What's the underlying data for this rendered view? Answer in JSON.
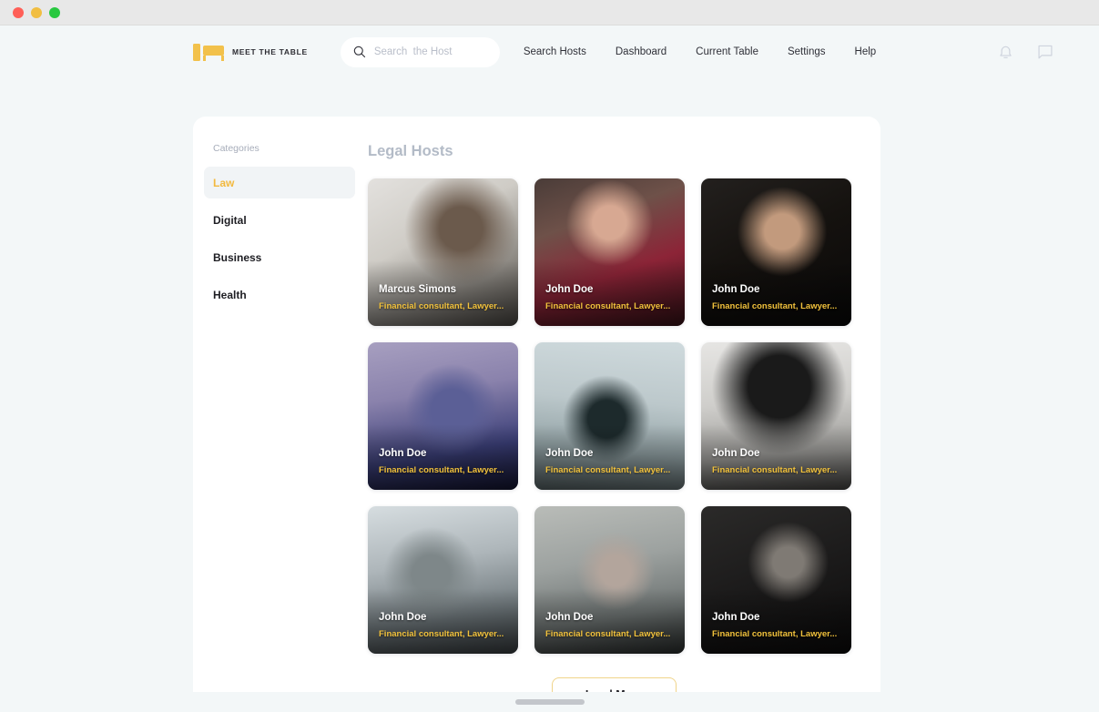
{
  "window": {
    "controls": [
      {
        "name": "close",
        "color": "#ff5f57"
      },
      {
        "name": "minimize",
        "color": "#f1be42"
      },
      {
        "name": "maximize",
        "color": "#28c840"
      }
    ]
  },
  "header": {
    "brand_text": "MEET THE TABLE",
    "brand_icon": "table-logo-icon",
    "search": {
      "icon": "search-icon",
      "placeholder": "Search  the Host",
      "value": ""
    },
    "nav_links": [
      {
        "label": "Search Hosts"
      },
      {
        "label": "Dashboard"
      },
      {
        "label": "Current Table"
      },
      {
        "label": "Settings"
      },
      {
        "label": "Help"
      }
    ],
    "icons": [
      {
        "name": "bell-icon",
        "label": "Notifications"
      },
      {
        "name": "chat-icon",
        "label": "Messages"
      }
    ]
  },
  "sidebar": {
    "title": "Categories",
    "items": [
      {
        "label": "Law",
        "active": true
      },
      {
        "label": "Digital",
        "active": false
      },
      {
        "label": "Business",
        "active": false
      },
      {
        "label": "Health",
        "active": false
      }
    ]
  },
  "main": {
    "title": "Legal Hosts",
    "cards": [
      {
        "name": "Marcus Simons",
        "role": "Financial consultant, Lawyer..."
      },
      {
        "name": "John Doe",
        "role": "Financial consultant, Lawyer..."
      },
      {
        "name": "John Doe",
        "role": "Financial consultant, Lawyer..."
      },
      {
        "name": "John Doe",
        "role": "Financial consultant, Lawyer..."
      },
      {
        "name": "John Doe",
        "role": "Financial consultant, Lawyer..."
      },
      {
        "name": "John Doe",
        "role": "Financial consultant, Lawyer..."
      },
      {
        "name": "John Doe",
        "role": "Financial consultant, Lawyer..."
      },
      {
        "name": "John Doe",
        "role": "Financial consultant, Lawyer..."
      },
      {
        "name": "John Doe",
        "role": "Financial consultant, Lawyer..."
      }
    ],
    "load_more_label": "Load More"
  },
  "colors": {
    "accent": "#f2c23c",
    "page_bg": "#f3f7f8",
    "panel_bg": "#ffffff",
    "title_muted": "#b3bbc7",
    "active_item_bg": "#f1f4f6"
  }
}
